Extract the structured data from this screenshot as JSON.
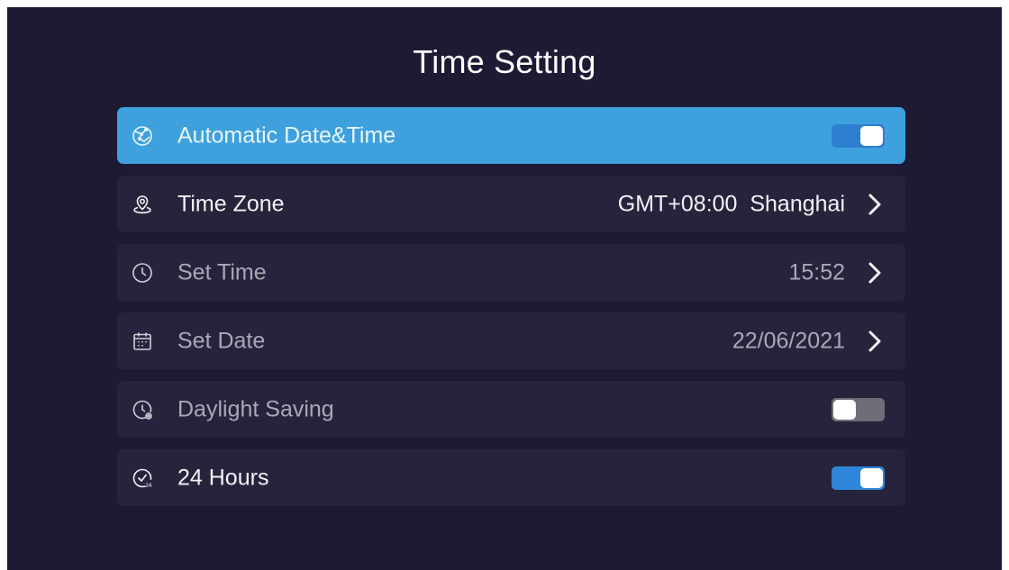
{
  "title": "Time Setting",
  "colors": {
    "background": "#1d1b34",
    "row": "#26243c",
    "focused_row": "#3ea1dd",
    "toggle_on": "#2f86d8",
    "toggle_off": "#6e6d78"
  },
  "rows": [
    {
      "label": "Automatic Date&Time",
      "icon": "globe-icon",
      "control": "toggle",
      "state": "on",
      "focused": true
    },
    {
      "label": "Time Zone",
      "icon": "location-pin-icon",
      "value": "GMT+08:00  Shanghai",
      "control": "chevron"
    },
    {
      "label": "Set Time",
      "icon": "clock-icon",
      "value": "15:52",
      "control": "chevron"
    },
    {
      "label": "Set Date",
      "icon": "calendar-icon",
      "value": "22/06/2021",
      "control": "chevron"
    },
    {
      "label": "Daylight Saving",
      "icon": "daylight-clock-icon",
      "control": "toggle",
      "state": "off"
    },
    {
      "label": "24 Hours",
      "icon": "clock-24-icon",
      "control": "toggle",
      "state": "on"
    }
  ]
}
